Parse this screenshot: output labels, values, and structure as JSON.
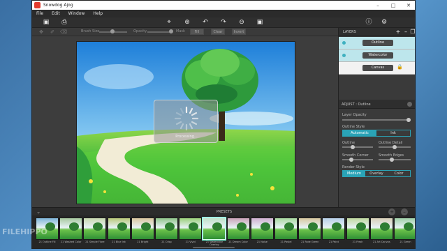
{
  "window": {
    "title": "Snowdog Ajog"
  },
  "menu": [
    "File",
    "Edit",
    "Window",
    "Help"
  ],
  "subbar": {
    "brush_size_label": "Brush Size",
    "opacity_label": "Opacity",
    "mask_label": "Mask",
    "fill_button": "Fill",
    "clear_button": "Clear",
    "invert_button": "Invert"
  },
  "canvas": {
    "loading_text": "Processing..."
  },
  "layers": {
    "title": "LAYERS",
    "items": [
      {
        "label": "Outline",
        "selected": true
      },
      {
        "label": "Watercolor",
        "selected": true
      },
      {
        "label": "Canvas",
        "selected": false,
        "locked": true
      }
    ]
  },
  "adjust": {
    "title": "ADJUST : Outline",
    "layer_opacity_label": "Layer Opacity",
    "outline_style_label": "Outline Style",
    "outline_style_options": [
      "Automatic",
      "Ink"
    ],
    "outline_style_selected": "Automatic",
    "outline_label": "Outline",
    "outline_detail_label": "Outline Detail",
    "smooth_corner_label": "Smooth Corner",
    "smooth_edges_label": "Smooth Edges",
    "render_style_label": "Render Style",
    "render_style_options": [
      "Medium",
      "Overlay",
      "Color"
    ],
    "render_style_selected": "Medium"
  },
  "presets": {
    "label": "PRESETS",
    "thumbs": [
      "21 Outline Fill",
      "21 Washed Color",
      "21 Simple Flare",
      "21 Blue Ink",
      "21 Bright",
      "21 Crisp",
      "21 Vivid",
      "21 Watercolor Overlay",
      "21 Dream Color",
      "21 Noise",
      "21 Pastel",
      "21 Fade Green",
      "21 Paint",
      "21 Fresh",
      "21 Art Canvas",
      "21 Green"
    ],
    "active_index": 7
  },
  "watermark": "FILEHIPPO"
}
